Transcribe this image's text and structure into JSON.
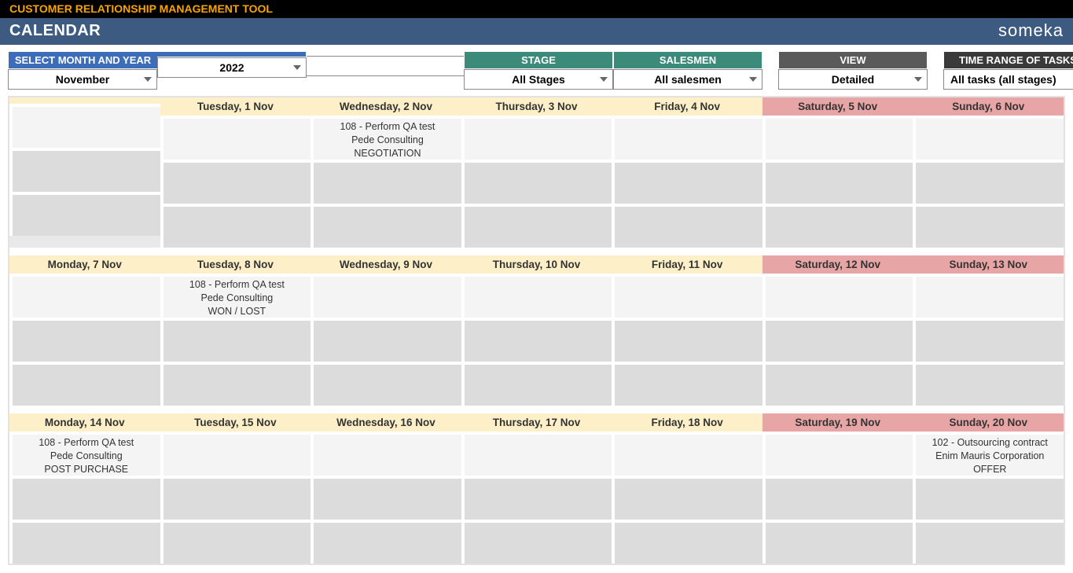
{
  "title": "CUSTOMER RELATIONSHIP MANAGEMENT TOOL",
  "page": "CALENDAR",
  "brand": "someka",
  "controls": {
    "month_year_header": "SELECT MONTH AND YEAR",
    "month": "November",
    "year": "2022",
    "stage_header": "STAGE",
    "stage": "All Stages",
    "salesmen_header": "SALESMEN",
    "salesmen": "All salesmen",
    "view_header": "VIEW",
    "view": "Detailed",
    "range_header": "TIME RANGE OF TASKS",
    "range": "All tasks (all stages)"
  },
  "weeks": [
    {
      "days": [
        {
          "label": "",
          "weekend": false,
          "slots": [
            "",
            "",
            ""
          ]
        },
        {
          "label": "Tuesday, 1 Nov",
          "weekend": false,
          "slots": [
            "",
            "",
            ""
          ]
        },
        {
          "label": "Wednesday, 2 Nov",
          "weekend": false,
          "slots": [
            "108 - Perform QA test\nPede Consulting\nNEGOTIATION",
            "",
            ""
          ]
        },
        {
          "label": "Thursday, 3 Nov",
          "weekend": false,
          "slots": [
            "",
            "",
            ""
          ]
        },
        {
          "label": "Friday, 4 Nov",
          "weekend": false,
          "slots": [
            "",
            "",
            ""
          ]
        },
        {
          "label": "Saturday, 5 Nov",
          "weekend": true,
          "slots": [
            "",
            "",
            ""
          ]
        },
        {
          "label": "Sunday, 6 Nov",
          "weekend": true,
          "slots": [
            "",
            "",
            ""
          ]
        }
      ]
    },
    {
      "days": [
        {
          "label": "Monday, 7 Nov",
          "weekend": false,
          "slots": [
            "",
            "",
            ""
          ]
        },
        {
          "label": "Tuesday, 8 Nov",
          "weekend": false,
          "slots": [
            "108 - Perform QA test\nPede Consulting\nWON / LOST",
            "",
            ""
          ]
        },
        {
          "label": "Wednesday, 9 Nov",
          "weekend": false,
          "slots": [
            "",
            "",
            ""
          ]
        },
        {
          "label": "Thursday, 10 Nov",
          "weekend": false,
          "slots": [
            "",
            "",
            ""
          ]
        },
        {
          "label": "Friday, 11 Nov",
          "weekend": false,
          "slots": [
            "",
            "",
            ""
          ]
        },
        {
          "label": "Saturday, 12 Nov",
          "weekend": true,
          "slots": [
            "",
            "",
            ""
          ]
        },
        {
          "label": "Sunday, 13 Nov",
          "weekend": true,
          "slots": [
            "",
            "",
            ""
          ]
        }
      ]
    },
    {
      "days": [
        {
          "label": "Monday, 14 Nov",
          "weekend": false,
          "slots": [
            "108 - Perform QA test\nPede Consulting\nPOST PURCHASE",
            "",
            ""
          ]
        },
        {
          "label": "Tuesday, 15 Nov",
          "weekend": false,
          "slots": [
            "",
            "",
            ""
          ]
        },
        {
          "label": "Wednesday, 16 Nov",
          "weekend": false,
          "slots": [
            "",
            "",
            ""
          ]
        },
        {
          "label": "Thursday, 17 Nov",
          "weekend": false,
          "slots": [
            "",
            "",
            ""
          ]
        },
        {
          "label": "Friday, 18 Nov",
          "weekend": false,
          "slots": [
            "",
            "",
            ""
          ]
        },
        {
          "label": "Saturday, 19 Nov",
          "weekend": true,
          "slots": [
            "",
            "",
            ""
          ]
        },
        {
          "label": "Sunday, 20 Nov",
          "weekend": true,
          "slots": [
            "102 - Outsourcing contract\nEnim Mauris Corporation\nOFFER",
            "",
            ""
          ]
        }
      ]
    }
  ]
}
